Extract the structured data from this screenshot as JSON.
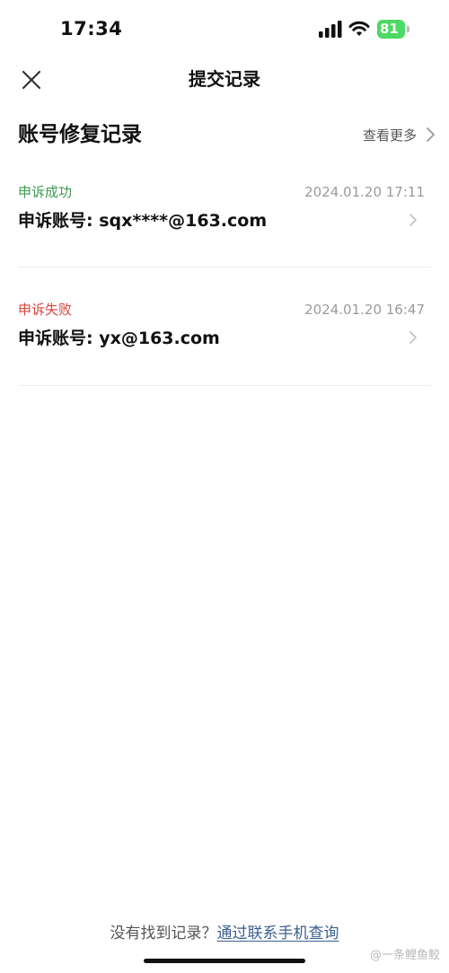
{
  "status_bar": {
    "time": "17:34",
    "battery": "81",
    "battery_color": "#4cd964"
  },
  "nav": {
    "title": "提交记录",
    "close_icon": "close-icon"
  },
  "section": {
    "title": "账号修复记录",
    "see_more": "查看更多"
  },
  "records": [
    {
      "status": "申诉成功",
      "status_color": "#3f9b52",
      "time": "2024.01.20 17:11",
      "account": "申诉账号: sqx****@163.com"
    },
    {
      "status": "申诉失败",
      "status_color": "#d7453c",
      "time": "2024.01.20 16:47",
      "account": "申诉账号: yx@163.com"
    }
  ],
  "footer": {
    "prompt": "没有找到记录？",
    "link": "通过联系手机查询",
    "link_color": "#3b5e8f"
  },
  "watermark": "@一条鲤鱼鲛"
}
